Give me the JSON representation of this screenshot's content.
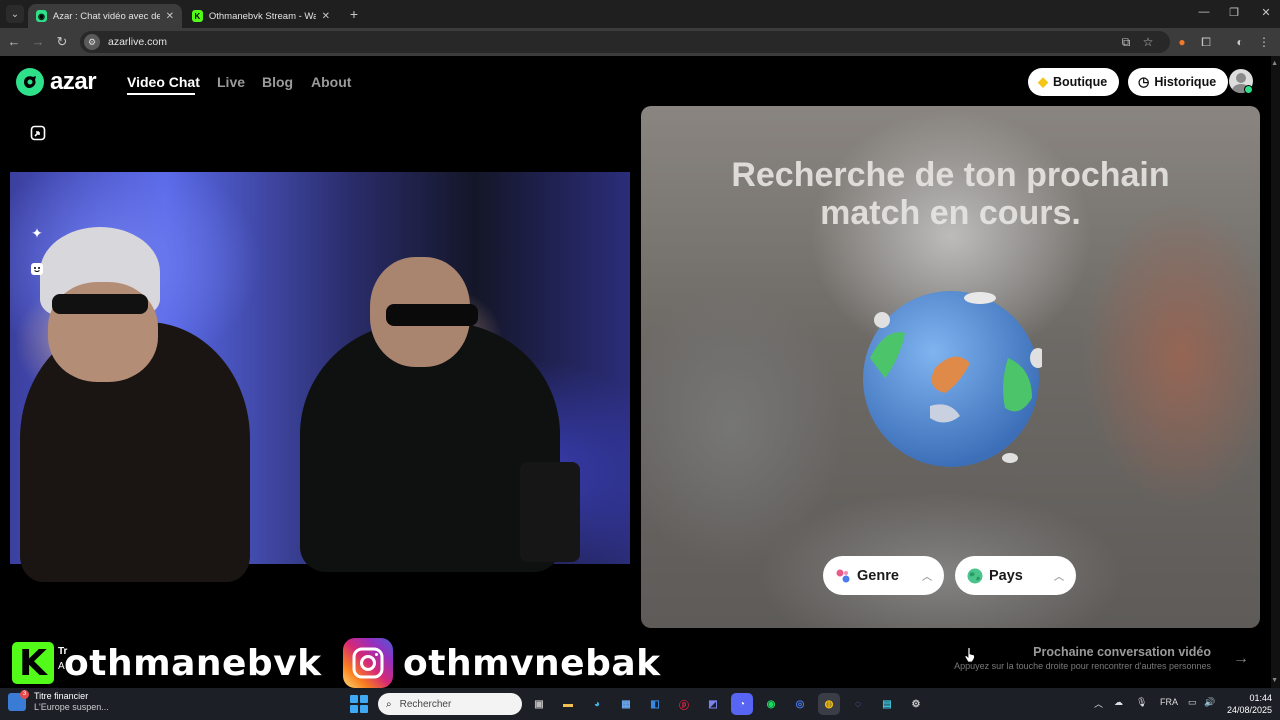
{
  "browser": {
    "tabs": [
      {
        "title": "Azar : Chat vidéo avec de n",
        "active": true
      },
      {
        "title": "Othmanebvk Stream - Watch Li",
        "active": false
      }
    ],
    "url": "azarlive.com"
  },
  "header": {
    "brand": "azar",
    "nav": [
      {
        "label": "Video Chat",
        "active": true
      },
      {
        "label": "Live",
        "active": false
      },
      {
        "label": "Blog",
        "active": false
      },
      {
        "label": "About",
        "active": false
      }
    ],
    "shop_label": "Boutique",
    "history_label": "Historique"
  },
  "search": {
    "title_line1": "Recherche de ton prochain",
    "title_line2": "match en cours.",
    "filters": [
      {
        "label": "Genre",
        "icon": "gender-icon"
      },
      {
        "label": "Pays",
        "icon": "globe-icon"
      }
    ]
  },
  "overlay": {
    "kick_handle": "othmanebvk",
    "instagram_handle": "othmvnebak",
    "partial_line1": "Tr",
    "partial_line2": "A"
  },
  "next": {
    "title": "Prochaine conversation vidéo",
    "subtitle": "Appuyez sur la touche droite pour rencontrer d'autres personnes"
  },
  "taskbar": {
    "news_title": "Titre financier",
    "news_subtitle": "L'Europe suspen...",
    "news_badge": "3",
    "search_placeholder": "Rechercher",
    "language": "FRA",
    "time": "01:44",
    "date": "24/08/2025"
  },
  "colors": {
    "brand_green": "#2ee08a",
    "kick_green": "#53fc18"
  }
}
